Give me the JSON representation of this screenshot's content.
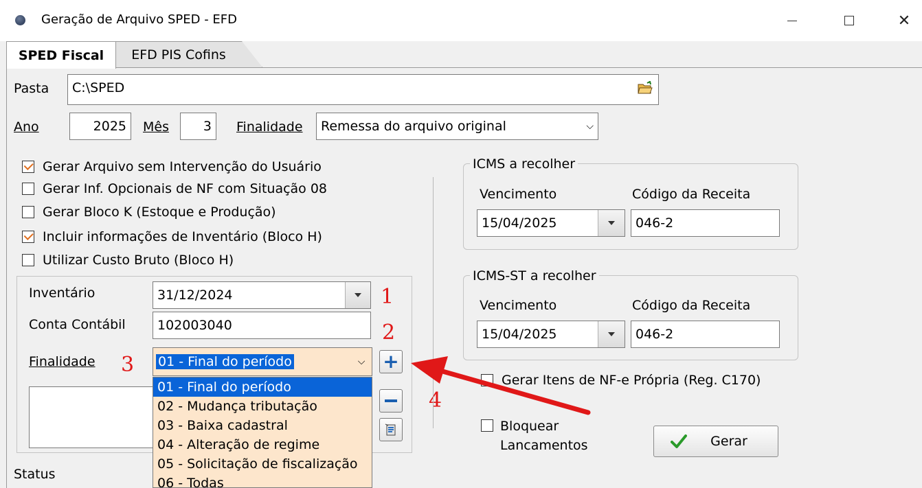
{
  "window": {
    "title": "Geração de Arquivo SPED - EFD",
    "close_glyph": "✕"
  },
  "tabs": [
    {
      "label": "SPED Fiscal"
    },
    {
      "label": "EFD PIS Cofins"
    }
  ],
  "form": {
    "pasta_label": "Pasta",
    "pasta_value": "C:\\SPED",
    "ano_label": "Ano",
    "ano_value": "2025",
    "mes_label": "Mês",
    "mes_value": "3",
    "finalidade_label": "Finalidade",
    "finalidade_value": "Remessa do arquivo original"
  },
  "checkboxes": [
    {
      "label": "Gerar Arquivo sem Intervenção do Usuário",
      "checked": true
    },
    {
      "label": "Gerar Inf. Opcionais de NF com Situação 08",
      "checked": false
    },
    {
      "label": "Gerar Bloco K (Estoque e Produção)",
      "checked": false
    },
    {
      "label": "Incluir informações de Inventário (Bloco H)",
      "checked": true
    },
    {
      "label": "Utilizar Custo Bruto (Bloco H)",
      "checked": false
    }
  ],
  "inventario": {
    "inventario_label": "Inventário",
    "inventario_value": "31/12/2024",
    "conta_label": "Conta Contábil",
    "conta_value": "102003040",
    "finalidade_label": "Finalidade",
    "finalidade_value": "01 - Final do período",
    "options": [
      "01 - Final do período",
      "02 - Mudança tributação",
      "03 - Baixa cadastral",
      "04 - Alteração de regime",
      "05 - Solicitação de fiscalização",
      "06 - Todas"
    ],
    "selected_index": 0
  },
  "icms": {
    "title": "ICMS a recolher",
    "vencimento_label": "Vencimento",
    "vencimento_value": "15/04/2025",
    "codigo_label": "Código da Receita",
    "codigo_value": "046-2"
  },
  "icms_st": {
    "title": "ICMS-ST a recolher",
    "vencimento_label": "Vencimento",
    "vencimento_value": "15/04/2025",
    "codigo_label": "Código da Receita",
    "codigo_value": "046-2"
  },
  "gerar_itens": {
    "label": "Gerar Itens de NF-e Própria (Reg. C170)",
    "checked": false
  },
  "bloquear": {
    "line1": "Bloquear",
    "line2": "Lancamentos",
    "checked": false
  },
  "gerar_button": "Gerar",
  "status_label": "Status",
  "annotations": [
    "1",
    "2",
    "3",
    "4"
  ],
  "colors": {
    "annotation": "#e01818",
    "selection": "#0a64d8",
    "dropdown_bg": "#fde6cc",
    "check": "#e07020"
  }
}
